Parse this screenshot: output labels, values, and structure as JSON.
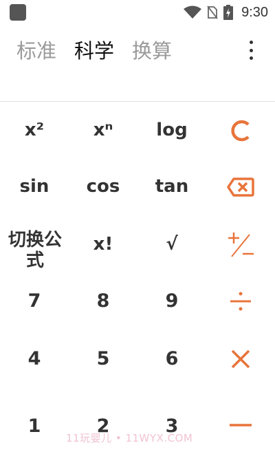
{
  "status_bar": {
    "time": "9:30",
    "icons": [
      "app-icon",
      "wifi-icon",
      "no-sim-icon",
      "battery-charging-icon"
    ]
  },
  "tabs": [
    {
      "label": "标准",
      "active": false
    },
    {
      "label": "科学",
      "active": true
    },
    {
      "label": "换算",
      "active": false
    }
  ],
  "menu": {
    "icon": "more-vert-icon"
  },
  "accent_color": "#e8743b",
  "keypad": {
    "row1": {
      "square": "x²",
      "power": "xⁿ",
      "log": "log",
      "clear_icon": "clear-icon"
    },
    "row2": {
      "sin": "sin",
      "cos": "cos",
      "tan": "tan",
      "backspace_icon": "backspace-icon"
    },
    "row3": {
      "switch_formula": "切换公式",
      "factorial": "x!",
      "sqrt": "√",
      "sign_icon": "plus-minus-icon"
    },
    "row4": {
      "seven": "7",
      "eight": "8",
      "nine": "9",
      "divide_icon": "divide-icon"
    },
    "row5": {
      "four": "4",
      "five": "5",
      "six": "6",
      "multiply_icon": "multiply-icon"
    },
    "row6": {
      "one": "1",
      "two": "2",
      "three": "3",
      "minus_icon": "minus-icon"
    }
  },
  "watermark": "11玩婴儿 • 11WYX.COM"
}
